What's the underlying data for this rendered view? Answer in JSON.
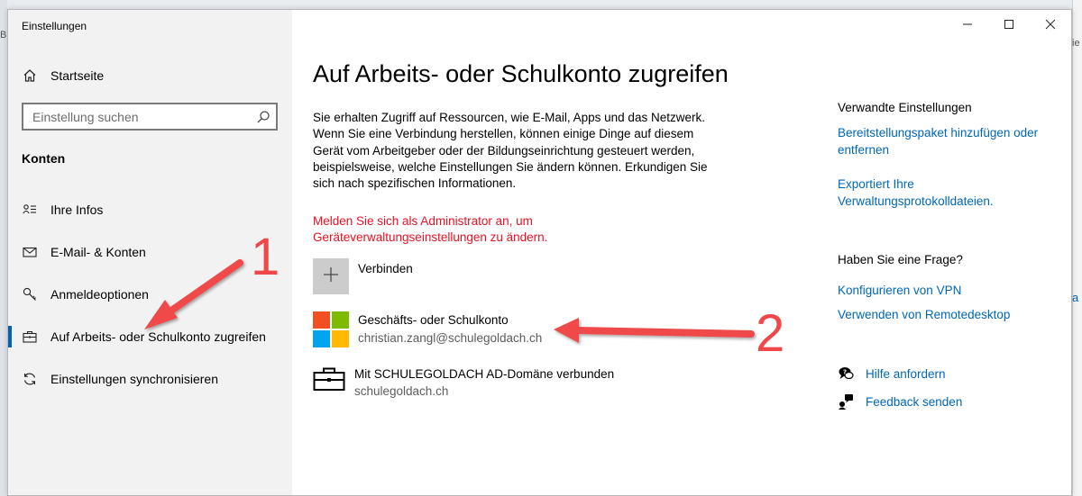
{
  "window": {
    "title": "Einstellungen"
  },
  "sidebar": {
    "home_label": "Startseite",
    "search_placeholder": "Einstellung suchen",
    "section_heading": "Konten",
    "items": [
      {
        "label": "Ihre Infos",
        "icon": "contact-card-icon",
        "active": false
      },
      {
        "label": "E-Mail- & Konten",
        "icon": "mail-icon",
        "active": false
      },
      {
        "label": "Anmeldeoptionen",
        "icon": "key-icon",
        "active": false
      },
      {
        "label": "Auf Arbeits- oder Schulkonto zugreifen",
        "icon": "briefcase-icon",
        "active": true
      },
      {
        "label": "Einstellungen synchronisieren",
        "icon": "sync-icon",
        "active": false
      }
    ]
  },
  "main": {
    "title": "Auf Arbeits- oder Schulkonto zugreifen",
    "description": "Sie erhalten Zugriff auf Ressourcen, wie E-Mail, Apps und das Netzwerk. Wenn Sie eine Verbindung herstellen, können einige Dinge auf diesem Gerät vom Arbeitgeber oder der Bildungseinrichtung gesteuert werden, beispielsweise, welche Einstellungen Sie ändern können. Erkundigen Sie sich nach spezifischen Informationen.",
    "admin_warning": "Melden Sie sich als Administrator an, um Geräteverwaltungseinstellungen zu ändern.",
    "connect_label": "Verbinden",
    "accounts": [
      {
        "title": "Geschäfts- oder Schulkonto",
        "subtitle": "christian.zangl@schulegoldach.ch",
        "icon": "microsoft-logo-icon"
      },
      {
        "title": "Mit SCHULEGOLDACH AD-Domäne verbunden",
        "subtitle": "schulegoldach.ch",
        "icon": "briefcase-icon"
      }
    ]
  },
  "related": {
    "heading": "Verwandte Einstellungen",
    "links": [
      "Bereitstellungspaket hinzufügen oder entfernen",
      "Exportiert Ihre Verwaltungsprotokolldateien."
    ],
    "question_heading": "Haben Sie eine Frage?",
    "question_links": [
      "Konfigurieren von VPN",
      "Verwenden von Remotedesktop"
    ],
    "help_label": "Hilfe anfordern",
    "feedback_label": "Feedback senden"
  },
  "annotations": {
    "marker_1": "1",
    "marker_2": "2",
    "color": "#f04848"
  },
  "colors": {
    "accent": "#0067b8",
    "warning": "#e81123",
    "sidebar_bg": "#f2f2f2"
  }
}
